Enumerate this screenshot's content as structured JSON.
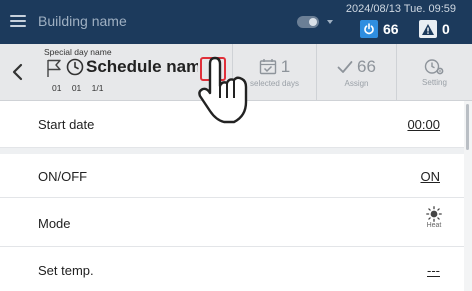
{
  "topbar": {
    "building_name": "Building name",
    "datetime": "2024/08/13 Tue. 09:59",
    "power_count": "66",
    "alert_count": "0"
  },
  "header": {
    "special_label": "Special day name",
    "schedule_name": "Schedule name",
    "sub_code": "01 01 1/1",
    "selected_days": {
      "value": "1",
      "label": "selected days"
    },
    "assign": {
      "value": "66",
      "label": "Assign"
    },
    "setting": {
      "label": "Setting"
    }
  },
  "rows": [
    {
      "label": "Start date",
      "value": "00:00"
    },
    {
      "label": "ON/OFF",
      "value": "ON"
    },
    {
      "label": "Mode",
      "value": "Heat"
    },
    {
      "label": "Set temp.",
      "value": "---"
    }
  ],
  "colors": {
    "topbar": "#1c3a5c",
    "header": "#e7e8ea",
    "power_accent": "#2f8ee0",
    "edit_highlight": "#e0303a"
  }
}
